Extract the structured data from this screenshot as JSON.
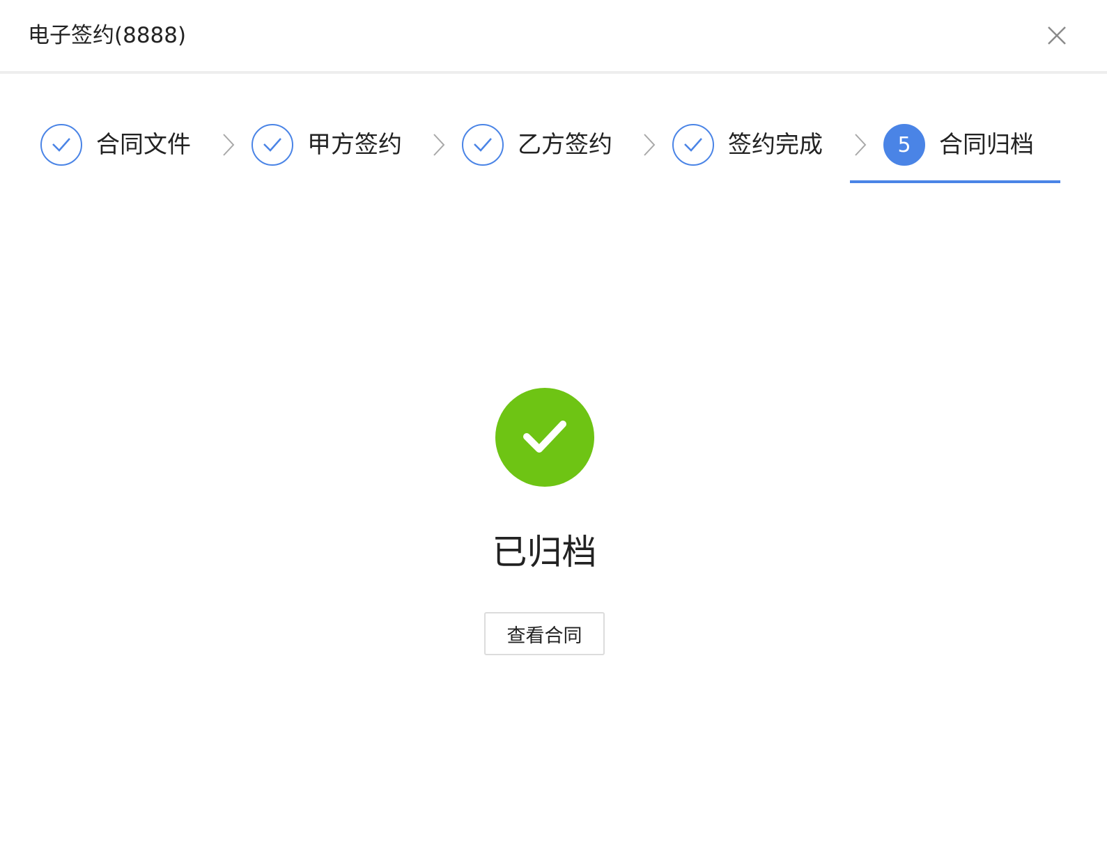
{
  "dialog": {
    "title": "电子签约(8888)"
  },
  "steps": [
    {
      "label": "合同文件",
      "status": "done"
    },
    {
      "label": "甲方签约",
      "status": "done"
    },
    {
      "label": "乙方签约",
      "status": "done"
    },
    {
      "label": "签约完成",
      "status": "done"
    },
    {
      "label": "合同归档",
      "status": "active",
      "number": "5"
    }
  ],
  "result": {
    "status_text": "已归档",
    "button_label": "查看合同"
  },
  "colors": {
    "primary": "#4a84e6",
    "success": "#6ec414",
    "divider": "#eeeeee",
    "text": "#222222"
  },
  "icons": {
    "close": "close-icon",
    "step_done": "check-icon",
    "separator": "chevron-right-icon",
    "result": "success-check-icon"
  }
}
